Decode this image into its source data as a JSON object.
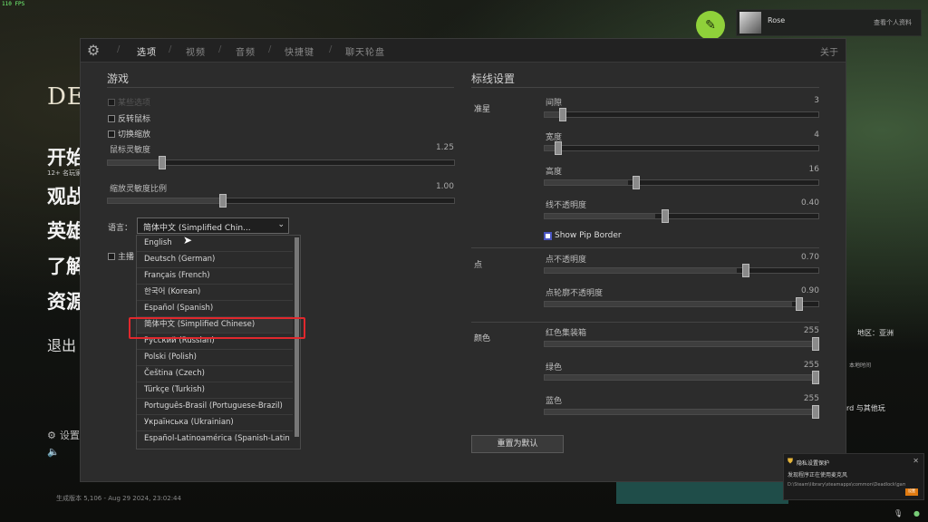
{
  "overlay": {
    "fps": "110 FPS"
  },
  "game": {
    "logo": "DE"
  },
  "side_menu": [
    "开始",
    "观战",
    "英雄",
    "了解",
    "资源",
    "退出"
  ],
  "side_menu_sub": "12+ 名玩家",
  "bottom": {
    "settings": "设置",
    "build": "生成版本 5,106 - Aug 29 2024, 23:02:44"
  },
  "profile": {
    "name": "Rose",
    "link": "查看个人资料"
  },
  "right_panel": {
    "region": "地区：亚洲",
    "local_time": "本地时间",
    "play_with": "rd 与其他玩"
  },
  "tabs": [
    "选项",
    "视频",
    "音频",
    "快捷键",
    "聊天轮盘",
    "关于"
  ],
  "game_section": {
    "title": "游戏",
    "checkbox_disabled": "某些选项",
    "invert_mouse": "反转鼠标",
    "toggle_zoom": "切换缩放",
    "mouse_sens": {
      "label": "鼠标灵敏度",
      "value": "1.25"
    },
    "zoom_sens": {
      "label": "缩放灵敏度比例",
      "value": "1.00"
    },
    "partial_label": "主播"
  },
  "language": {
    "label": "语言：",
    "selected": "简体中文 (Simplified Chin...",
    "options": [
      "English",
      "Deutsch (German)",
      "Français (French)",
      "한국어 (Korean)",
      "Español (Spanish)",
      "简体中文 (Simplified Chinese)",
      "Русский (Russian)",
      "Polski (Polish)",
      "Čeština (Czech)",
      "Türkçe (Turkish)",
      "Português-Brasil (Portuguese-Brazil)",
      "Українська (Ukrainian)",
      "Español-Latinoamérica (Spanish-Latin"
    ]
  },
  "crosshair": {
    "title": "标线设置",
    "groups": [
      "准星",
      "点",
      "颜色"
    ],
    "gap": {
      "label": "间隙",
      "value": "3"
    },
    "width": {
      "label": "宽度",
      "value": "4"
    },
    "height": {
      "label": "高度",
      "value": "16"
    },
    "line_opacity": {
      "label": "线不透明度",
      "value": "0.40"
    },
    "show_pip_border": "Show Pip Border",
    "dot_opacity": {
      "label": "点不透明度",
      "value": "0.70"
    },
    "dot_outline_opacity": {
      "label": "点轮廓不透明度",
      "value": "0.90"
    },
    "red": {
      "label": "红色集装箱",
      "value": "255"
    },
    "green": {
      "label": "绿色",
      "value": "255"
    },
    "blue": {
      "label": "蓝色",
      "value": "255"
    },
    "reset": "重置为默认"
  },
  "notification": {
    "title": "隐私设置保护",
    "body": "发现程序正在使用麦克风",
    "path": "D:\\Steam\\library\\steamapps\\common\\Deadlock\\game\\b",
    "action": "设置"
  }
}
